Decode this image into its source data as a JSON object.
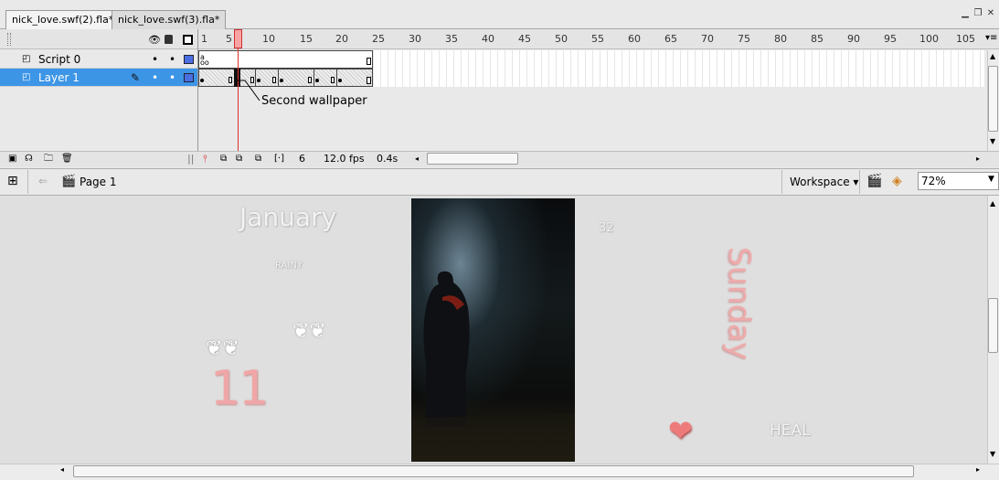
{
  "tabs": [
    {
      "label": "nick_love.swf(2).fla*",
      "active": true
    },
    {
      "label": "nick_love.swf(3).fla*",
      "active": false
    }
  ],
  "timeline": {
    "frame_numbers": [
      "1",
      "5",
      "10",
      "15",
      "20",
      "25",
      "30",
      "35",
      "40",
      "45",
      "50",
      "55",
      "60",
      "65",
      "70",
      "75",
      "80",
      "85",
      "90",
      "95",
      "100",
      "105"
    ],
    "layers": [
      {
        "name": "Script 0",
        "selected": false
      },
      {
        "name": "Layer 1",
        "selected": true
      }
    ],
    "annotation": "Second wallpaper",
    "current_frame": "6",
    "fps": "12.0 fps",
    "elapsed": "0.4s"
  },
  "editbar": {
    "scene": "Page 1",
    "workspace": "Workspace",
    "zoom": "72%"
  },
  "stage": {
    "month": "January",
    "weather": "RAINY",
    "temp": "32",
    "day": "Sunday",
    "date": "11",
    "heal": "HEAL"
  },
  "colors": {
    "selected_row": "#3d95e6",
    "playhead": "#e03030",
    "day_text": "#f0a6a6",
    "heart": "#ee7b7b"
  }
}
